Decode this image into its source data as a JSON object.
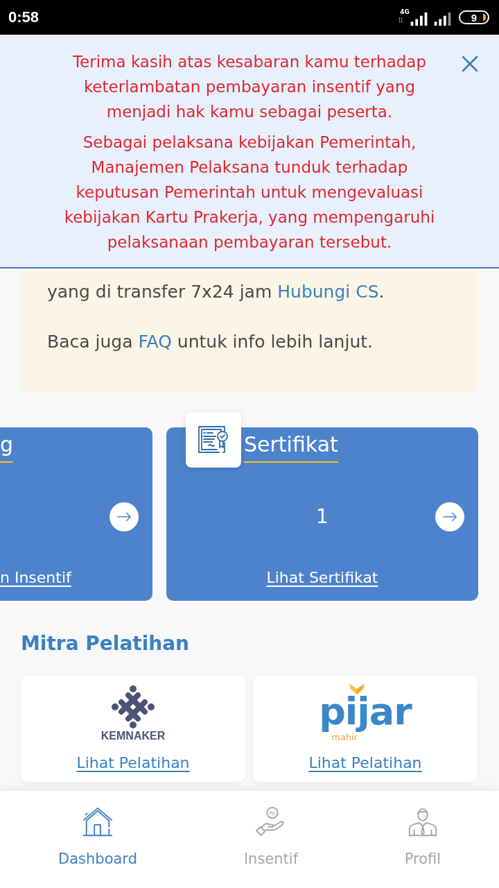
{
  "status_bar": {
    "time": "0:58",
    "network": "4G",
    "battery": "9"
  },
  "notice": {
    "paragraphs": [
      "Terima kasih atas kesabaran kamu terhadap keterlambatan pembayaran insentif yang menjadi hak kamu sebagai peserta.",
      "Sebagai pelaksana kebijakan Pemerintah, Manajemen Pelaksana tunduk terhadap keputusan Pemerintah untuk mengevaluasi kebijakan Kartu Prakerja, yang mempengaruhi pelaksanaan pembayaran tersebut."
    ]
  },
  "info_box": {
    "paragraphs": [
      {
        "text": "yang di transfer 7x24 jam ",
        "link": "Hubungi CS",
        "after": "."
      },
      {
        "text": "Baca juga ",
        "link": "FAQ",
        "after": " untuk info lebih lanjut."
      }
    ]
  },
  "cards": [
    {
      "kind": "clipped",
      "title": "g",
      "link": "n Insentif"
    },
    {
      "kind": "full",
      "title": "Sertifikat",
      "value": "1",
      "link": "Lihat Sertifikat"
    }
  ],
  "partners": {
    "title": "Mitra Pelatihan",
    "items": [
      {
        "kind": "kemnaker",
        "logo_text": "KEMNAKER",
        "link": "Lihat Pelatihan"
      },
      {
        "kind": "pijar",
        "logo_text": "pijar",
        "logo_subtext": "mahir",
        "link": "Lihat Pelatihan"
      }
    ]
  },
  "bottom_nav": [
    {
      "label": "Dashboard",
      "selected": true
    },
    {
      "label": "Insentif",
      "selected": false,
      "coin_text": "Rp"
    },
    {
      "label": "Profil",
      "selected": false
    }
  ]
}
